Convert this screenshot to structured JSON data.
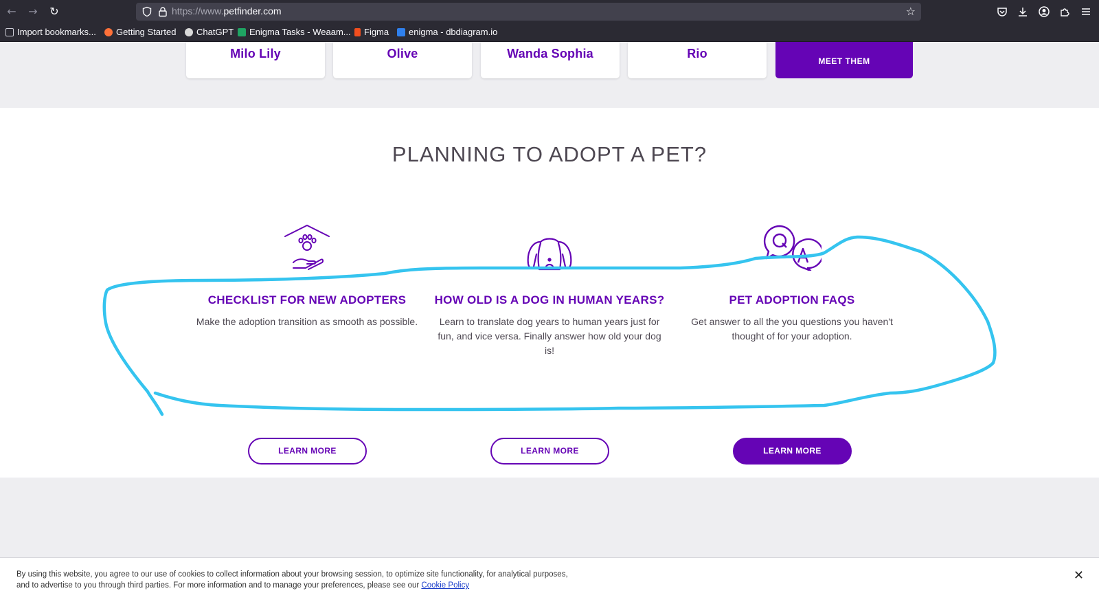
{
  "browser": {
    "url_prefix": "https://www.",
    "url_domain": "petfinder.com",
    "bookmarks": [
      {
        "label": "Import bookmarks...",
        "color": "#cfcfd8"
      },
      {
        "label": "Getting Started",
        "color": "#ff7139"
      },
      {
        "label": "ChatGPT",
        "color": "#d9d9d9"
      },
      {
        "label": "Enigma Tasks - Weaam...",
        "color": "#1fa463"
      },
      {
        "label": "Figma",
        "color": "#f24e1e"
      },
      {
        "label": "enigma - dbdiagram.io",
        "color": "#2f80ed"
      }
    ]
  },
  "pets": {
    "cards": [
      "Milo Lily",
      "Olive",
      "Wanda Sophia",
      "Rio"
    ],
    "meet_label": "MEET THEM"
  },
  "section": {
    "title": "PLANNING TO ADOPT A PET?",
    "columns": [
      {
        "icon": "paw-house-hand-icon",
        "heading": "CHECKLIST FOR NEW ADOPTERS",
        "text": "Make the adoption transition as smooth as possible.",
        "button": "LEARN MORE"
      },
      {
        "icon": "dog-face-icon",
        "heading": "HOW OLD IS A DOG IN HUMAN YEARS?",
        "text": "Learn to translate dog years to human years just for fun, and vice versa. Finally answer how old your dog is!",
        "button": "LEARN MORE"
      },
      {
        "icon": "qa-bubbles-icon",
        "heading": "PET ADOPTION FAQS",
        "text": "Get answer to all the you questions you haven't thought of for your adoption.",
        "button": "LEARN MORE"
      }
    ]
  },
  "cookie": {
    "line1": "By using this website, you agree to our use of cookies to collect information about your browsing session, to optimize site functionality, for analytical purposes,",
    "line2": "and to advertise to you through third parties. For more information and to manage your preferences, please see our",
    "link": "Cookie Policy"
  },
  "colors": {
    "brand_purple": "#6504b5",
    "annotation_blue": "#35c4ef"
  }
}
